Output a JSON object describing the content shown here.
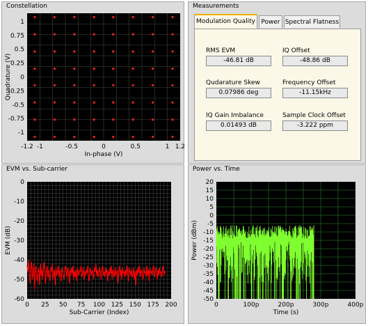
{
  "constellation": {
    "title": "Constellation",
    "xlabel": "In-phase (V)",
    "ylabel": "Quadrature (V)",
    "xticks": [
      "-1.2",
      "-1",
      "-0.5",
      "0",
      "0.5",
      "1",
      "1.2"
    ],
    "yticks": [
      "1",
      "0.75",
      "0.5",
      "0.25",
      "0",
      "-0.25",
      "-0.5",
      "-0.75",
      "-1"
    ]
  },
  "measurements": {
    "title": "Measurements",
    "tabs": [
      "Modulation Quality",
      "Power",
      "Spectral Flatness"
    ],
    "active_tab": "Modulation Quality",
    "items": [
      {
        "label": "RMS EVM",
        "value": "-46.81 dB"
      },
      {
        "label": "IQ Offset",
        "value": "-48.86 dB"
      },
      {
        "label": "Qudarature Skew",
        "value": "0.07986 deg"
      },
      {
        "label": "Frequency Offset",
        "value": "-11.15kHz"
      },
      {
        "label": "IQ Gain Imbalance",
        "value": "0.01493 dB"
      },
      {
        "label": "Sample Clock Offset",
        "value": "-3.222 ppm"
      }
    ]
  },
  "evm": {
    "title": "EVM vs. Sub-carrier",
    "xlabel": "Sub-Carrier (Index)",
    "ylabel": "EVM (dB)",
    "xticks": [
      "0",
      "25",
      "50",
      "75",
      "100",
      "125",
      "150",
      "175",
      "200"
    ],
    "yticks": [
      "0",
      "-10",
      "-20",
      "-30",
      "-40",
      "-50",
      "-60"
    ]
  },
  "power": {
    "title": "Power vs. Time",
    "xlabel": "Time (s)",
    "ylabel": "Power (dBm)",
    "xticks": [
      "0",
      "100p",
      "200p",
      "300p",
      "400p"
    ],
    "yticks": [
      "20",
      "15",
      "10",
      "5",
      "0",
      "-5",
      "-10",
      "-15",
      "-20",
      "-25",
      "-30",
      "-35",
      "-40",
      "-45",
      "-50"
    ]
  },
  "chart_data": [
    {
      "type": "scatter",
      "title": "Constellation",
      "xlabel": "In-phase (V)",
      "ylabel": "Quadrature (V)",
      "xlim": [
        -1.2,
        1.2
      ],
      "ylim": [
        -1.15,
        1.15
      ],
      "grid": true,
      "points_grid_levels": [
        -1.08,
        -0.77,
        -0.46,
        -0.15,
        0.15,
        0.46,
        0.77,
        1.08
      ],
      "color": "#ff2020"
    },
    {
      "type": "line",
      "title": "EVM vs. Sub-carrier",
      "xlabel": "Sub-Carrier (Index)",
      "ylabel": "EVM (dB)",
      "xlim": [
        0,
        200
      ],
      "ylim": [
        -60,
        0
      ],
      "x_range": [
        0,
        192
      ],
      "values": [
        -43,
        -46,
        -40,
        -48,
        -52,
        -44,
        -41,
        -50,
        -47,
        -42,
        -55,
        -45,
        -43,
        -49,
        -51,
        -44,
        -46,
        -53,
        -42,
        -48,
        -45,
        -50,
        -44,
        -41,
        -47,
        -52,
        -46,
        -43,
        -49,
        -45,
        -48,
        -51,
        -44,
        -46,
        -42,
        -50,
        -47,
        -45,
        -53,
        -44,
        -48,
        -46,
        -43,
        -49,
        -45,
        -47,
        -51,
        -44,
        -46,
        -48,
        -50,
        -45,
        -43,
        -47,
        -49,
        -44,
        -46,
        -52,
        -45,
        -48,
        -44,
        -47,
        -43,
        -50,
        -46,
        -49,
        -45,
        -51,
        -44,
        -47,
        -48,
        -45,
        -46,
        -43,
        -49,
        -47,
        -44,
        -50,
        -46,
        -48,
        -45,
        -47,
        -43,
        -49,
        -51,
        -44,
        -46,
        -48,
        -45,
        -47,
        -50,
        -44,
        -46,
        -42,
        -48,
        -45,
        -49,
        -47,
        -44,
        -46,
        -50,
        -45,
        -43,
        -48,
        -46,
        -49,
        -44,
        -47,
        -45,
        -51,
        -46,
        -48,
        -44,
        -47,
        -43,
        -50,
        -45,
        -46,
        -49,
        -44,
        -48,
        -47,
        -45,
        -52,
        -46,
        -43,
        -48,
        -45,
        -50,
        -44,
        -47,
        -46,
        -49,
        -45,
        -48,
        -43,
        -47,
        -51,
        -44,
        -46,
        -48,
        -45,
        -49,
        -47,
        -44,
        -50,
        -46,
        -53,
        -45,
        -48,
        -44,
        -47,
        -43,
        -49,
        -46,
        -45,
        -48,
        -50,
        -44,
        -47,
        -46,
        -49,
        -43,
        -48,
        -45,
        -51,
        -44,
        -47,
        -46,
        -48,
        -45,
        -43,
        -49,
        -47,
        -44,
        -46,
        -50,
        -45,
        -48,
        -44,
        -47,
        -46,
        -49,
        -45,
        -43,
        -48,
        -46,
        -47
      ],
      "color": "#ff0000"
    },
    {
      "type": "area",
      "title": "Power vs. Time",
      "xlabel": "Time (s)",
      "ylabel": "Power (dBm)",
      "xlim": [
        0,
        400
      ],
      "x_unit": "p",
      "ylim": [
        -50,
        20
      ],
      "x_range": [
        0,
        280
      ],
      "upper_envelope_approx": -6,
      "floor": -50,
      "color": "#80ff30"
    }
  ]
}
